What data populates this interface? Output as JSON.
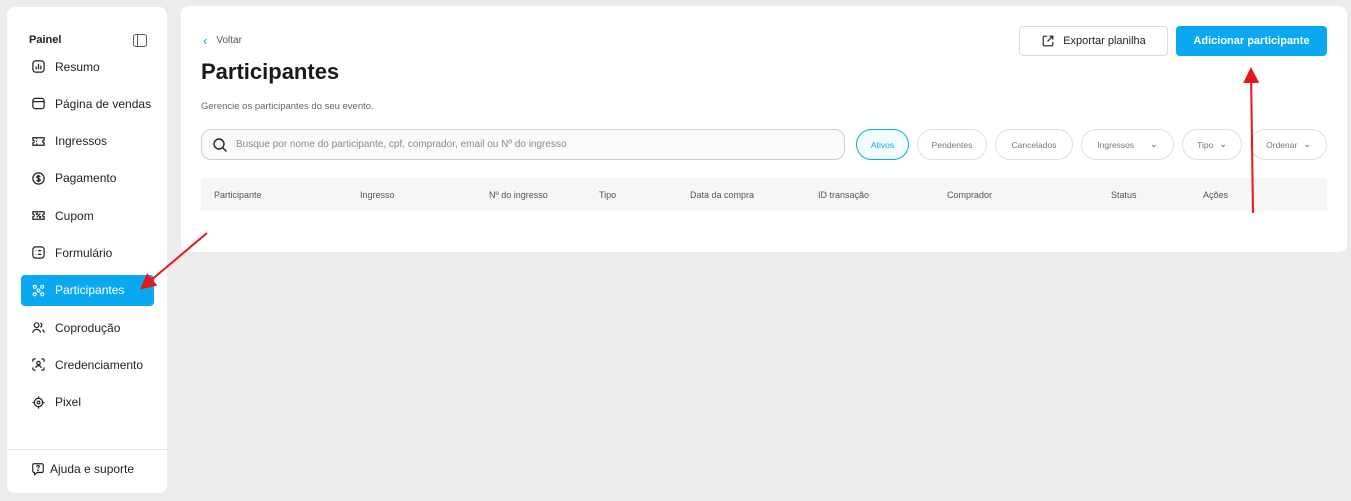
{
  "sidebar": {
    "title": "Painel",
    "items": [
      {
        "label": "Resumo",
        "icon": "chart-icon"
      },
      {
        "label": "Página de vendas",
        "icon": "browser-icon"
      },
      {
        "label": "Ingressos",
        "icon": "ticket-icon"
      },
      {
        "label": "Pagamento",
        "icon": "dollar-icon"
      },
      {
        "label": "Cupom",
        "icon": "coupon-icon"
      },
      {
        "label": "Formulário",
        "icon": "form-icon"
      },
      {
        "label": "Participantes",
        "icon": "participants-icon",
        "active": true
      },
      {
        "label": "Coprodução",
        "icon": "users-icon"
      },
      {
        "label": "Credenciamento",
        "icon": "badge-scan-icon"
      },
      {
        "label": "Pixel",
        "icon": "crosshair-icon"
      }
    ],
    "help_label": "Ajuda e suporte"
  },
  "header": {
    "back_label": "Voltar",
    "title": "Participantes",
    "subtitle": "Gerencie os participantes do seu evento.",
    "export_label": "Exportar planilha",
    "add_label": "Adicionar participante"
  },
  "search": {
    "placeholder": "Busque por nome do participante, cpf, comprador, email ou Nº do ingresso",
    "value": ""
  },
  "filters": {
    "ativos": "Ativos",
    "pendentes": "Pendentes",
    "cancelados": "Cancelados",
    "ingressos": "Ingressos",
    "tipo": "Tipo",
    "ordenar": "Ordenar"
  },
  "table": {
    "columns": [
      "Participante",
      "Ingresso",
      "Nº do ingresso",
      "Tipo",
      "Data da compra",
      "ID transação",
      "Comprador",
      "Status",
      "Ações"
    ],
    "rows": []
  },
  "colors": {
    "accent": "#0aa8f0",
    "annotation": "#e8161b",
    "background": "#ececec"
  }
}
